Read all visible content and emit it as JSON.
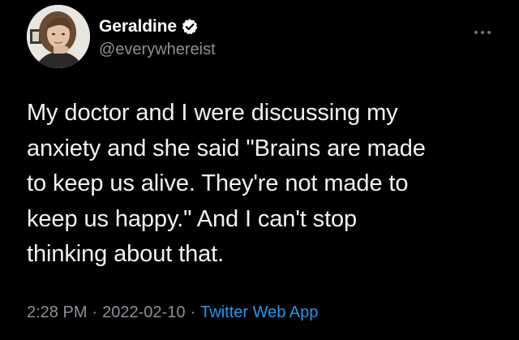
{
  "tweet": {
    "author": {
      "display_name": "Geraldine",
      "handle": "@everywhereist",
      "verified": true,
      "verified_color": "#ffffff"
    },
    "more_icon": "more-dots-icon",
    "text": "My doctor and I were discussing my\nanxiety and she said \"Brains are made\nto keep us alive. They're not made to\nkeep us happy.\" And I can't stop\nthinking about that.",
    "time": "2:28 PM",
    "separator": "·",
    "date": "2022-02-10",
    "source": "Twitter Web App",
    "colors": {
      "background": "#000000",
      "text": "#e7e9ea",
      "muted": "#8b9096",
      "link": "#1d9bf0"
    }
  }
}
